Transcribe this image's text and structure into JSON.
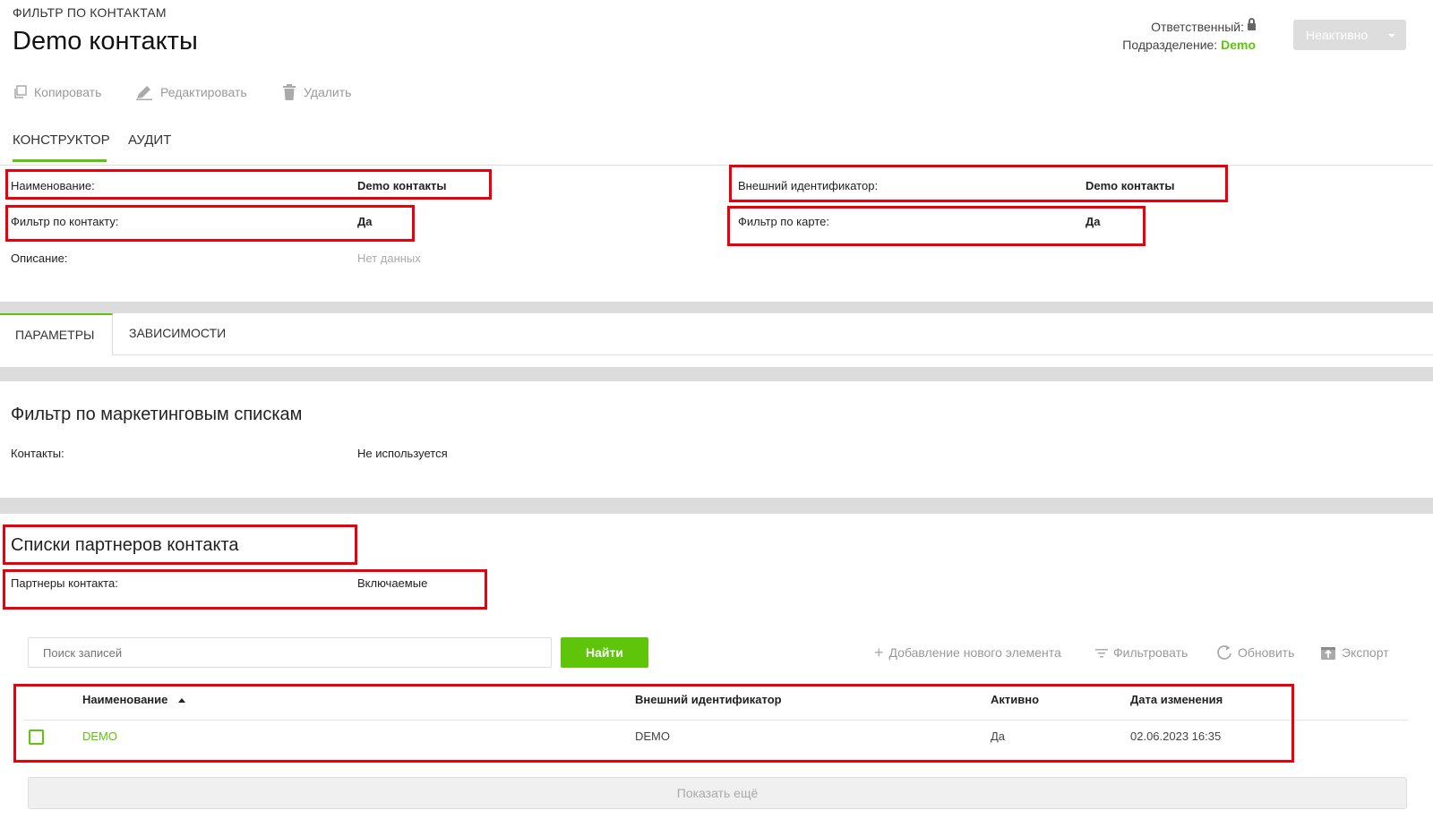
{
  "header": {
    "breadcrumb": "ФИЛЬТР ПО КОНТАКТАМ",
    "title": "Demo контакты",
    "responsible_label": "Ответственный:",
    "department_label": "Подразделение:",
    "department_value": "Demo",
    "status_button": "Неактивно"
  },
  "toolbar": {
    "copy": "Копировать",
    "edit": "Редактировать",
    "delete": "Удалить"
  },
  "tabs": {
    "constructor": "КОНСТРУКТОР",
    "audit": "АУДИТ"
  },
  "fields": {
    "name_label": "Наименование:",
    "name_value": "Demo контакты",
    "contact_filter_label": "Фильтр по контакту:",
    "contact_filter_value": "Да",
    "description_label": "Описание:",
    "description_value": "Нет данных",
    "external_id_label": "Внешний идентификатор:",
    "external_id_value": "Demo контакты",
    "card_filter_label": "Фильтр по карте:",
    "card_filter_value": "Да"
  },
  "subtabs": {
    "params": "ПАРАМЕТРЫ",
    "deps": "ЗАВИСИМОСТИ"
  },
  "marketing": {
    "heading": "Фильтр по маркетинговым спискам",
    "contacts_label": "Контакты:",
    "contacts_value": "Не используется"
  },
  "partners": {
    "heading": "Списки партнеров контакта",
    "partners_label": "Партнеры контакта:",
    "partners_value": "Включаемые"
  },
  "search": {
    "placeholder": "Поиск записей",
    "find_button": "Найти"
  },
  "actions": {
    "add": "Добавление нового элемента",
    "filter": "Фильтровать",
    "refresh": "Обновить",
    "export": "Экспорт"
  },
  "table": {
    "columns": [
      "Наименование",
      "Внешний идентификатор",
      "Активно",
      "Дата изменения"
    ],
    "rows": [
      {
        "name": "DEMO",
        "external_id": "DEMO",
        "active": "Да",
        "modified": "02.06.2023 16:35"
      }
    ],
    "show_more": "Показать ещё"
  },
  "colors": {
    "accent": "#5fc50b",
    "highlight": "#e8000b"
  }
}
